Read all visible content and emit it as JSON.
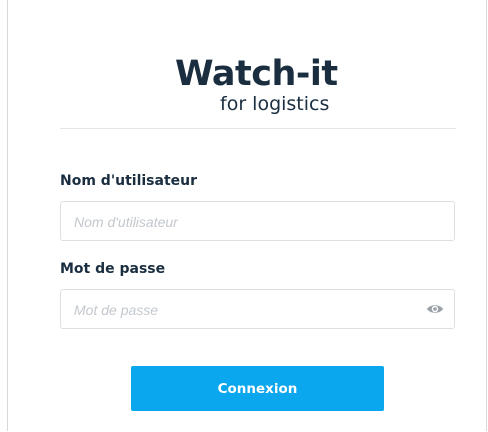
{
  "brand": {
    "name": "Watch-it",
    "tagline": "for logistics"
  },
  "form": {
    "username": {
      "label": "Nom d'utilisateur",
      "placeholder": "Nom d'utilisateur",
      "value": ""
    },
    "password": {
      "label": "Mot de passe",
      "placeholder": "Mot de passe",
      "value": "",
      "toggle_icon": "eye-icon"
    },
    "submit_label": "Connexion"
  },
  "colors": {
    "brand_text": "#1a2e40",
    "accent_button": "#0aa6ee",
    "placeholder": "#c3c8cd"
  }
}
